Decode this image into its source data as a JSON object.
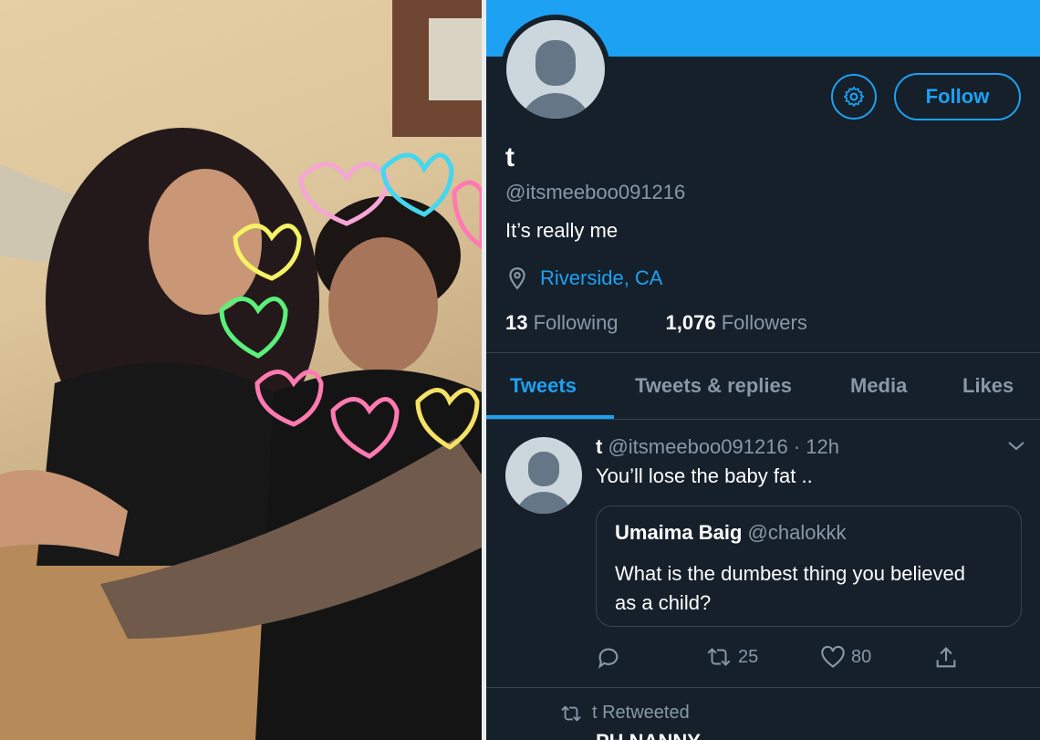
{
  "colors": {
    "accent": "#1da1f2",
    "background": "#15202b",
    "muted": "#8899a6",
    "border": "#38444d"
  },
  "profile": {
    "name": "t",
    "handle": "@itsmeeboo091216",
    "bio": "It’s really me",
    "location": "Riverside, CA",
    "following_count": "13",
    "following_label": "Following",
    "followers_count": "1,076",
    "followers_label": "Followers",
    "follow_label": "Follow"
  },
  "tabs": [
    {
      "label": "Tweets",
      "active": true
    },
    {
      "label": "Tweets & replies"
    },
    {
      "label": "Media"
    },
    {
      "label": "Likes"
    }
  ],
  "tweet": {
    "name": "t",
    "handle": "@itsmeeboo091216",
    "time": "· 12h",
    "text": "You’ll lose the baby fat ..",
    "quote": {
      "name": "Umaima Baig",
      "handle": "@chalokkk",
      "text": "What is the dumbest thing you believed as a child?"
    },
    "retweets": "25",
    "likes": "80"
  },
  "next_item": {
    "retweeted_label": "t Retweeted",
    "partial_name": "PH NANNY"
  }
}
